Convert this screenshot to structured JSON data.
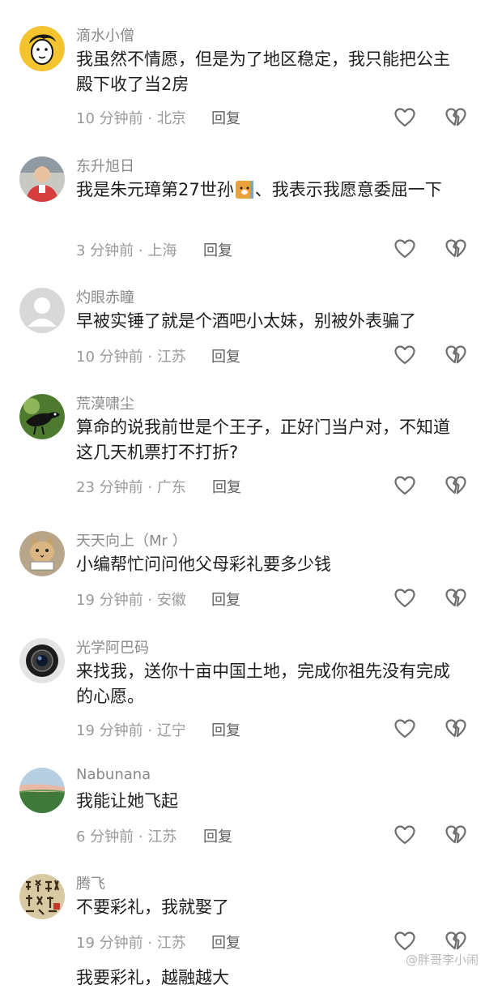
{
  "comments": [
    {
      "username": "滴水小僧",
      "text": "我虽然不情愿，但是为了地区稳定，我只能把公主殿下收了当2房",
      "time": "10 分钟前",
      "location": "北京",
      "reply": "回复",
      "avatar_icon": "cartoon-face-avatar"
    },
    {
      "username": "东升旭日",
      "text_before": "我是朱元璋第27世孙",
      "text_after": "、我表示我愿意委屈一下",
      "time": "3 分钟前",
      "location": "上海",
      "reply": "回复",
      "avatar_icon": "person-photo-avatar"
    },
    {
      "username": "灼眼赤瞳",
      "text": "早被实锤了就是个酒吧小太妹，别被外表骗了",
      "time": "10 分钟前",
      "location": "江苏",
      "reply": "回复",
      "avatar_icon": "default-user-avatar"
    },
    {
      "username": "荒漠啸尘",
      "text": "算命的说我前世是个王子，正好门当户对，不知道这几天机票打不打折?",
      "time": "23 分钟前",
      "location": "广东",
      "reply": "回复",
      "avatar_icon": "bird-avatar"
    },
    {
      "username": "天天向上（Mr ）",
      "text": "小编帮忙问问他父母彩礼要多少钱",
      "time": "19 分钟前",
      "location": "安徽",
      "reply": "回复",
      "avatar_icon": "cat-avatar"
    },
    {
      "username": "光学阿巴码",
      "text": "来找我，送你十亩中国土地，完成你祖先没有完成的心愿。",
      "time": "19 分钟前",
      "location": "辽宁",
      "reply": "回复",
      "avatar_icon": "camera-lens-avatar"
    },
    {
      "username": "Nabunana",
      "text": "我能让她飞起",
      "time": "6 分钟前",
      "location": "江苏",
      "reply": "回复",
      "avatar_icon": "landscape-avatar"
    },
    {
      "username": "腾飞",
      "text": "不要彩礼，我就娶了",
      "time": "19 分钟前",
      "location": "江苏",
      "reply": "回复",
      "avatar_icon": "calligraphy-avatar"
    }
  ],
  "cutoff_text": "我要彩礼，越融越大",
  "watermark": "@胖哥李小闹",
  "colors": {
    "username": "#8a8a8a",
    "text": "#1e1e1e",
    "meta": "#9a9a9a",
    "icon": "#7a7a7a"
  }
}
